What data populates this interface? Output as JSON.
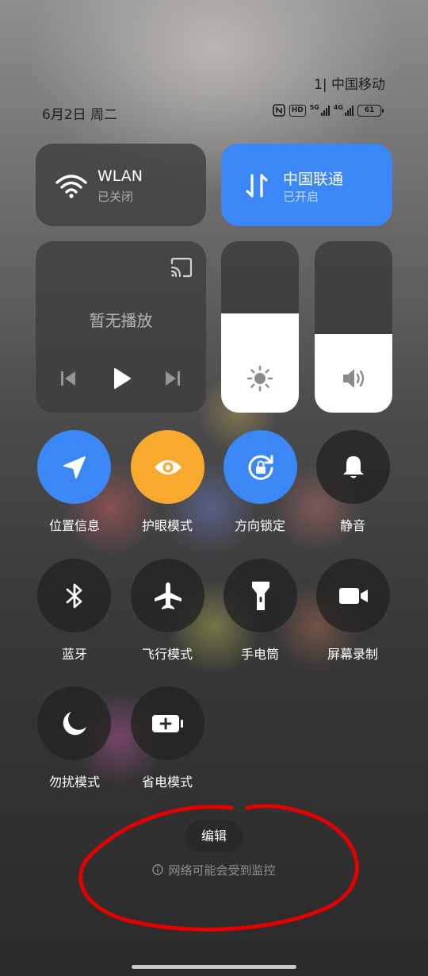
{
  "status": {
    "carrier_line": "1| 中国移动",
    "date": "6月2日 周二",
    "hd": "HD",
    "sig1_label": "5G",
    "sig2_label": "4G",
    "battery": "61",
    "icons": [
      "nfc-icon",
      "hd-voice-icon",
      "signal-icon",
      "battery-icon"
    ]
  },
  "tiles": {
    "wlan": {
      "title": "WLAN",
      "sub": "已关闭",
      "icon": "wifi-icon"
    },
    "cellular": {
      "title": "中国联通",
      "sub": "已开启",
      "icon": "data-arrows-icon",
      "color": "#3a87f5"
    }
  },
  "media": {
    "title": "暂无播放",
    "icons": [
      "cast-icon",
      "previous-icon",
      "play-icon",
      "next-icon"
    ]
  },
  "sliders": {
    "brightness": {
      "level": 0.58,
      "icon": "brightness-icon"
    },
    "volume": {
      "level": 0.46,
      "icon": "volume-icon"
    }
  },
  "toggles": [
    {
      "label": "位置信息",
      "icon": "location-icon",
      "state": "on"
    },
    {
      "label": "护眼模式",
      "icon": "eye-icon",
      "state": "on"
    },
    {
      "label": "方向锁定",
      "icon": "rotation-lock-icon",
      "state": "on"
    },
    {
      "label": "静音",
      "icon": "bell-icon",
      "state": "off"
    },
    {
      "label": "蓝牙",
      "icon": "bluetooth-icon",
      "state": "off"
    },
    {
      "label": "飞行模式",
      "icon": "airplane-icon",
      "state": "off"
    },
    {
      "label": "手电筒",
      "icon": "flashlight-icon",
      "state": "off"
    },
    {
      "label": "屏幕录制",
      "icon": "video-camera-icon",
      "state": "off"
    },
    {
      "label": "勿扰模式",
      "icon": "moon-icon",
      "state": "off"
    },
    {
      "label": "省电模式",
      "icon": "battery-saver-icon",
      "state": "off"
    }
  ],
  "footer": {
    "edit": "编辑",
    "warning": "网络可能会受到监控",
    "warning_icon": "info-icon"
  },
  "colors": {
    "accent_blue": "#3a87f5",
    "accent_orange": "#f7aa2d",
    "annotation_red": "#e30000"
  }
}
